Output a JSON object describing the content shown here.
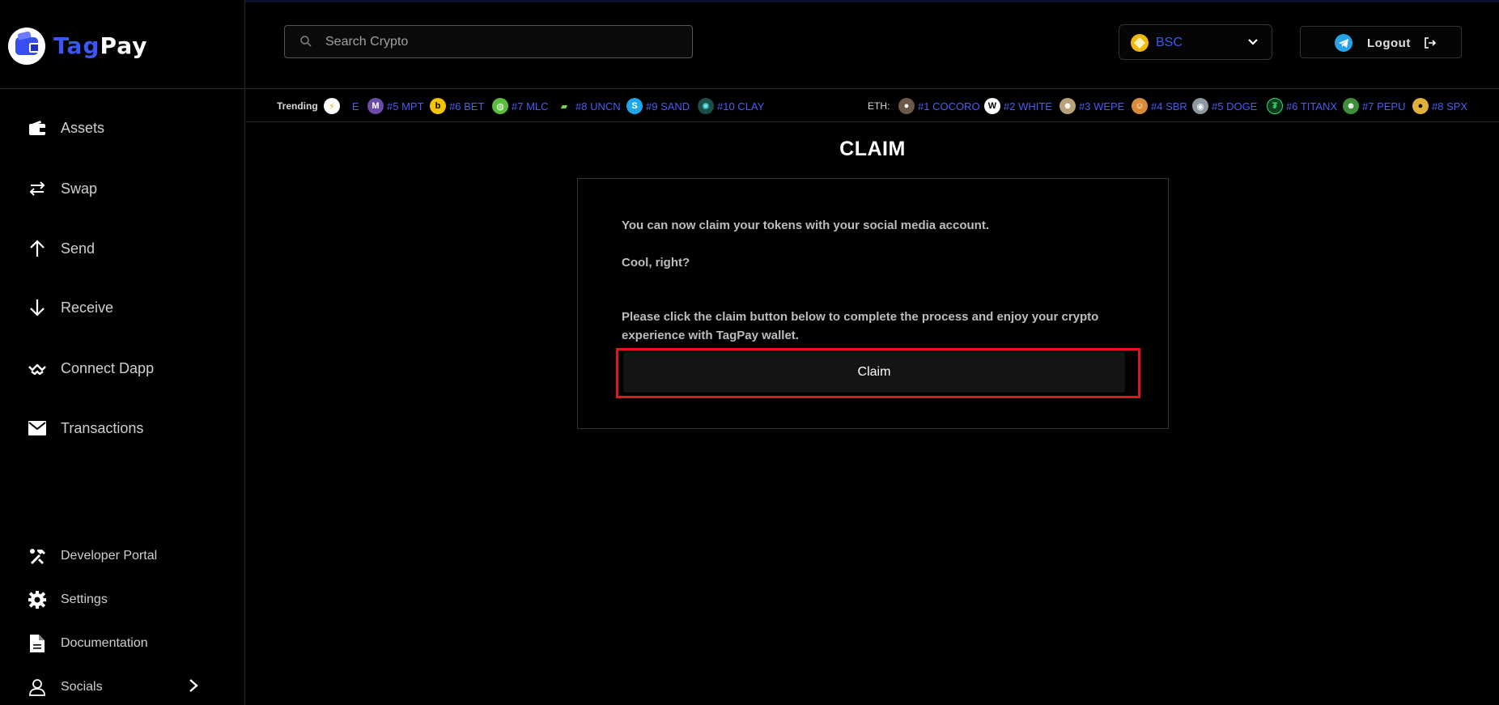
{
  "brand": {
    "name_part1": "Tag",
    "name_part2": "Pay"
  },
  "sidebar": {
    "main_items": [
      {
        "label": "Assets",
        "icon": "wallet-icon"
      },
      {
        "label": "Swap",
        "icon": "swap-arrows-icon"
      },
      {
        "label": "Send",
        "icon": "arrow-up-icon"
      },
      {
        "label": "Receive",
        "icon": "arrow-down-icon"
      },
      {
        "label": "Connect Dapp",
        "icon": "walletconnect-icon"
      },
      {
        "label": "Transactions",
        "icon": "envelope-icon"
      }
    ],
    "bottom_items": [
      {
        "label": "Developer Portal",
        "icon": "tools-icon"
      },
      {
        "label": "Settings",
        "icon": "gear-icon"
      },
      {
        "label": "Documentation",
        "icon": "document-icon"
      },
      {
        "label": "Socials",
        "icon": "user-icon"
      }
    ]
  },
  "header": {
    "search_placeholder": "Search Crypto",
    "network": "BSC",
    "logout_label": "Logout"
  },
  "ticker": {
    "trending_label": "Trending",
    "trending": [
      "E",
      "#5 MPT",
      "#6 BET",
      "#7 MLC",
      "#8 UNCN",
      "#9 SAND",
      "#10 CLAY"
    ],
    "eth_label": "ETH:",
    "eth": [
      "#1 COCORO",
      "#2 WHITE",
      "#3 WEPE",
      "#4 SBR",
      "#5 DOGE",
      "#6 TITANX",
      "#7 PEPU",
      "#8 SPX"
    ]
  },
  "claim": {
    "title": "CLAIM",
    "line1": "You can now claim your tokens with your social media account.",
    "line2": "Cool, right?",
    "line3a": "Please click the claim button below to complete the process and enjoy your crypto",
    "line3b": "experience with TagPay wallet.",
    "button": "Claim"
  },
  "colors": {
    "accent": "#3a57f5",
    "highlight_box": "#e0161d",
    "bsc_coin": "#f0b90b",
    "telegram": "#2aa3e6"
  }
}
